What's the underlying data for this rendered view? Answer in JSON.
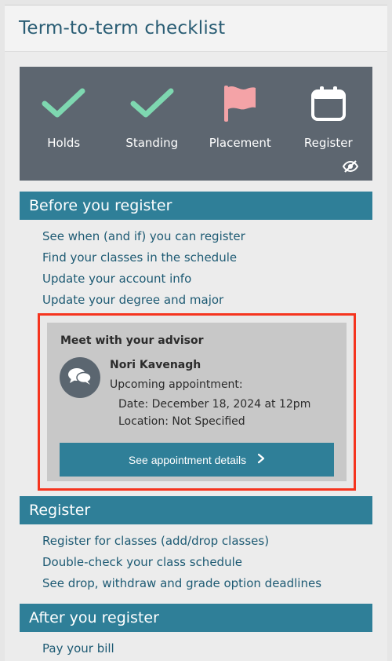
{
  "page": {
    "title": "Term-to-term checklist"
  },
  "status": {
    "items": [
      {
        "label": "Holds",
        "icon": "checkmark-icon"
      },
      {
        "label": "Standing",
        "icon": "checkmark-icon"
      },
      {
        "label": "Placement",
        "icon": "flag-icon"
      },
      {
        "label": "Register",
        "icon": "calendar-icon",
        "badge_icon": "eye-slash-icon"
      }
    ],
    "colors": {
      "check": "#7ed7b0",
      "flag": "#f4a3a7",
      "box": "#5d6670"
    }
  },
  "before": {
    "header": "Before you register",
    "links": [
      "See when (and if) you can register",
      "Find your classes in the schedule",
      "Update your account info",
      "Update your degree and major"
    ]
  },
  "advisor": {
    "title": "Meet with your advisor",
    "name": "Nori Kavenagh",
    "appointment_label": "Upcoming appointment:",
    "date": "Date: December 18, 2024 at 12pm",
    "location": "Location: Not Specified",
    "button_label": "See appointment details",
    "button_icon": "chevron-right-icon",
    "avatar_icon": "chat-bubbles-icon",
    "highlight_color": "#f5341e"
  },
  "register": {
    "header": "Register",
    "links": [
      "Register for classes (add/drop classes)",
      "Double-check your class schedule",
      "See drop, withdraw and grade option deadlines"
    ]
  },
  "after": {
    "header": "After you register",
    "links": [
      "Pay your bill"
    ]
  },
  "theme": {
    "accent": "#2f7f98",
    "link": "#1d5a73"
  }
}
